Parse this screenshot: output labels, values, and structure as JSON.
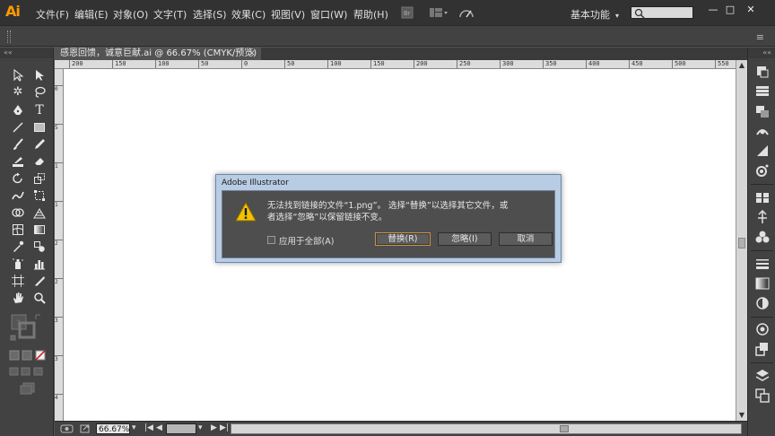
{
  "app": {
    "logo_text": "Ai"
  },
  "menu": {
    "items": [
      "文件(F)",
      "编辑(E)",
      "对象(O)",
      "文字(T)",
      "选择(S)",
      "效果(C)",
      "视图(V)",
      "窗口(W)",
      "帮助(H)"
    ]
  },
  "workspace": {
    "label": "基本功能",
    "caret": "▾"
  },
  "window_controls": {
    "minimize": "—",
    "restore": "□",
    "close": "✕"
  },
  "control_bar": {
    "menu_glyph": "≡"
  },
  "panels": {
    "collapse_left": "««",
    "collapse_right": "««"
  },
  "document": {
    "tab_title": "感恩回馈，诚意巨献.ai @ 66.67% (CMYK/预览)",
    "tab_close": "×"
  },
  "ruler": {
    "h_ticks": [
      "200",
      "150",
      "100",
      "50",
      "0",
      "50",
      "100",
      "150",
      "200",
      "250",
      "300",
      "350",
      "400",
      "450",
      "500",
      "550"
    ],
    "v_ticks": [
      "0",
      "5",
      "1",
      "1",
      "2",
      "2",
      "3",
      "3",
      "4"
    ]
  },
  "status": {
    "zoom": "66.67%",
    "artboard": ""
  },
  "dialog": {
    "title": "Adobe Illustrator",
    "message_line1": "无法找到链接的文件“1.png”。 选择“替换”以选择其它文件，或",
    "message_line2": "者选择“忽略”以保留链接不变。",
    "apply_all_label": "应用于全部(A)",
    "apply_all_checked": false,
    "replace_label": "替换(R)",
    "ignore_label": "忽略(I)",
    "cancel_label": "取消"
  },
  "colors": {
    "logo": "#ff9a00",
    "ui_dark": "#323232",
    "ui_panel": "#424242",
    "canvas": "#ffffff",
    "dialog_frame": "#b8cce4",
    "warning": "#f2c200"
  }
}
